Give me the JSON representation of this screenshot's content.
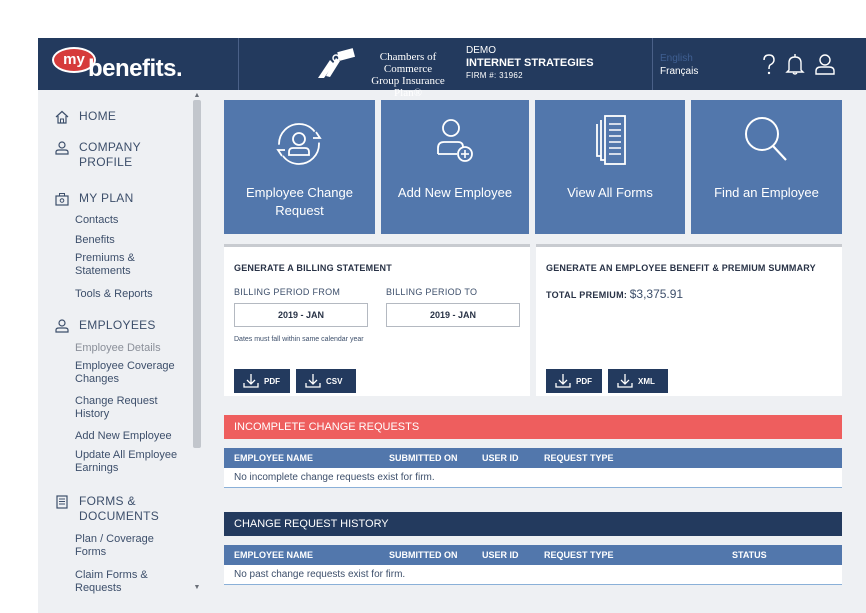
{
  "header": {
    "logo_my": "my",
    "logo_word": "benefits.",
    "chamber_line1": "Chambers of Commerce",
    "chamber_line2": "Group Insurance Plan®",
    "demo": "DEMO",
    "firm_name": "INTERNET STRATEGIES",
    "firm_number": "FIRM #: 31962",
    "lang_en": "English",
    "lang_fr": "Français",
    "icons": [
      "help-icon",
      "bell-icon",
      "user-icon"
    ]
  },
  "sidebar": {
    "home": "HOME",
    "company_line1": "COMPANY",
    "company_line2": "PROFILE",
    "myplan": "MY PLAN",
    "myplan_items": [
      "Contacts",
      "Benefits",
      "Premiums & Statements",
      "Tools & Reports"
    ],
    "employees": "EMPLOYEES",
    "employees_items": [
      "Employee Details",
      "Employee Coverage Changes",
      "Change Request History",
      "Add New Employee",
      "Update All Employee Earnings"
    ],
    "forms_line1": "FORMS &",
    "forms_line2": "DOCUMENTS",
    "forms_items": [
      "Plan / Coverage Forms",
      "Claim Forms & Requests"
    ]
  },
  "tiles": [
    {
      "label": "Employee Change Request",
      "icon": "change-request-icon"
    },
    {
      "label": "Add New Employee",
      "icon": "add-user-icon"
    },
    {
      "label": "View All Forms",
      "icon": "forms-icon"
    },
    {
      "label": "Find an Employee",
      "icon": "search-icon"
    }
  ],
  "billing": {
    "title": "GENERATE A BILLING STATEMENT",
    "from_label": "BILLING PERIOD FROM",
    "to_label": "BILLING PERIOD TO",
    "from_value": "2019 - JAN",
    "to_value": "2019 - JAN",
    "note": "Dates must fall within same calendar year",
    "pdf": "PDF",
    "csv": "CSV"
  },
  "summary": {
    "title": "GENERATE AN EMPLOYEE BENEFIT & PREMIUM SUMMARY",
    "total_label": "TOTAL PREMIUM:",
    "total_value": "$3,375.91",
    "pdf": "PDF",
    "xml": "XML"
  },
  "incomplete": {
    "title": "INCOMPLETE CHANGE REQUESTS",
    "columns": [
      "EMPLOYEE NAME",
      "SUBMITTED ON",
      "USER ID",
      "REQUEST TYPE"
    ],
    "empty": "No incomplete change requests exist for firm."
  },
  "history": {
    "title": "CHANGE REQUEST HISTORY",
    "columns": [
      "EMPLOYEE NAME",
      "SUBMITTED ON",
      "USER ID",
      "REQUEST TYPE",
      "STATUS"
    ],
    "empty": "No past change requests exist for firm."
  },
  "colors": {
    "navy": "#233a5e",
    "tile_blue": "#5277ac",
    "alert_red": "#ee5e5e"
  }
}
